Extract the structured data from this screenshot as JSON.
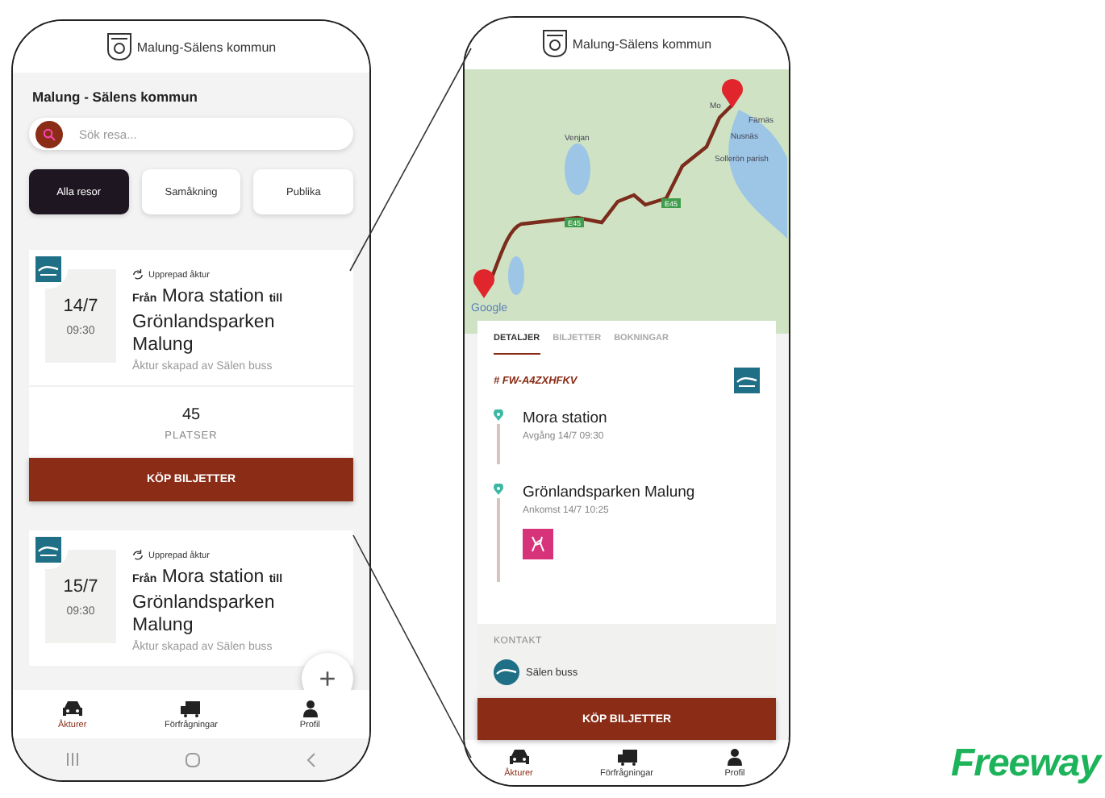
{
  "left_phone": {
    "header": {
      "title": "Malung-Sälens kommun"
    },
    "page_title": "Malung - Sälens kommun",
    "search": {
      "placeholder": "Sök resa..."
    },
    "filters": [
      {
        "label": "Alla resor",
        "selected": true
      },
      {
        "label": "Samåkning",
        "selected": false
      },
      {
        "label": "Publika",
        "selected": false
      }
    ],
    "trips": [
      {
        "repeat_label": "Upprepad åktur",
        "date": "14/7",
        "time": "09:30",
        "route": "**Från** Mora station **till** Grönlandsparken Malung",
        "creator": "Åktur skapad av Sälen buss",
        "seats": "45",
        "seats_label": "PLATSER",
        "button": "KÖP BILJETTER"
      },
      {
        "repeat_label": "Upprepad åktur",
        "date": "15/7",
        "time": "09:30",
        "route": "**Från** Mora station **till** Grönlandsparken Malung",
        "creator": "Åktur skapad av Sälen buss"
      }
    ],
    "fab": "+",
    "bottom_nav": [
      {
        "label": "Åkturer",
        "selected": true
      },
      {
        "label": "Förfrågningar",
        "selected": false
      },
      {
        "label": "Profil",
        "selected": false
      }
    ]
  },
  "right_phone": {
    "header": {
      "title": "Malung-Sälens kommun"
    },
    "map": {
      "labels": [
        {
          "text": "Venjan"
        },
        {
          "text": "Mo"
        },
        {
          "text": "Färnäs"
        },
        {
          "text": "Nusnäs"
        },
        {
          "text": "Sollerön parish"
        },
        {
          "text": "Google"
        }
      ],
      "road_labels": [
        "E45",
        "E45"
      ]
    },
    "tabs": [
      {
        "label": "DETALJER",
        "selected": true
      },
      {
        "label": "BILJETTER",
        "selected": false
      },
      {
        "label": "BOKNINGAR",
        "selected": false
      }
    ],
    "booking_id": "# FW-A4ZXHFKV",
    "stops": [
      {
        "name": "Mora station",
        "detail": "Avgång 14/7 09:30"
      },
      {
        "name": "Grönlandsparken Malung",
        "detail": "Ankomst 14/7 10:25"
      }
    ],
    "contact": {
      "heading": "KONTAKT",
      "name": "Sälen buss"
    },
    "button": "KÖP BILJETTER",
    "bottom_nav": [
      {
        "label": "Åkturer",
        "selected": true
      },
      {
        "label": "Förfrågningar",
        "selected": false
      },
      {
        "label": "Profil",
        "selected": false
      }
    ]
  },
  "brand": "Freeway"
}
